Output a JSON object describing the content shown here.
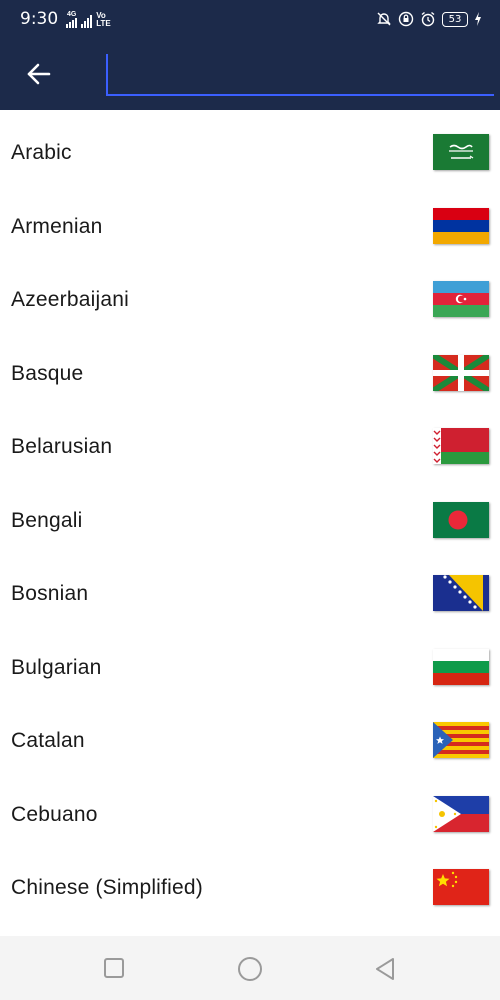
{
  "status_bar": {
    "time": "9:30",
    "network_label": "4G",
    "volte_label_top": "Vo",
    "volte_label_bottom": "LTE",
    "battery_level": "53",
    "icons": [
      "signal-icon",
      "mute-icon",
      "vpn-icon",
      "alarm-icon",
      "battery-icon",
      "charging-icon"
    ]
  },
  "app_bar": {
    "back_icon": "arrow-left-icon",
    "search_value": "",
    "search_placeholder": ""
  },
  "languages": [
    {
      "name": "Arabic",
      "flag": "saudi-arabia"
    },
    {
      "name": "Armenian",
      "flag": "armenia"
    },
    {
      "name": "Azeerbaijani",
      "flag": "azerbaijan"
    },
    {
      "name": "Basque",
      "flag": "basque"
    },
    {
      "name": "Belarusian",
      "flag": "belarus"
    },
    {
      "name": "Bengali",
      "flag": "bangladesh"
    },
    {
      "name": "Bosnian",
      "flag": "bosnia"
    },
    {
      "name": "Bulgarian",
      "flag": "bulgaria"
    },
    {
      "name": "Catalan",
      "flag": "catalonia"
    },
    {
      "name": "Cebuano",
      "flag": "philippines"
    },
    {
      "name": "Chinese (Simplified)",
      "flag": "china"
    }
  ],
  "nav_bar": {
    "icons": [
      "recents-square-icon",
      "home-circle-icon",
      "back-triangle-icon"
    ]
  },
  "colors": {
    "app_bar": "#1c2a4a",
    "search_underline": "#3b5fff",
    "text": "#1a1a1a",
    "nav_bar": "#f4f4f4"
  }
}
